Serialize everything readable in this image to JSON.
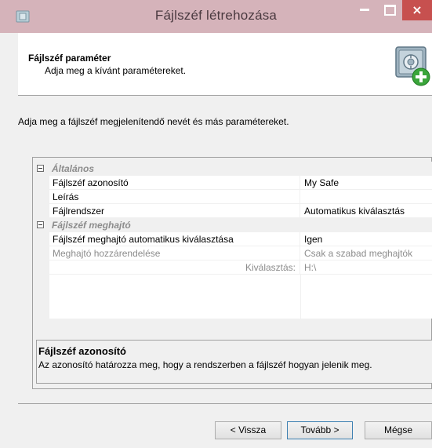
{
  "window": {
    "title": "Fájlszéf létrehozása",
    "close_glyph": "×"
  },
  "header": {
    "heading": "Fájlszéf paraméter",
    "subheading": "Adja meg a kívánt paramétereket.",
    "icon": "safe-add-icon"
  },
  "description": "Adja meg a fájlszéf megjelenítendő nevét és más paramétereket.",
  "property_grid": {
    "categories": [
      {
        "label": "Általános",
        "properties": [
          {
            "name": "Fájlszéf azonosító",
            "value": "My Safe"
          },
          {
            "name": "Leírás",
            "value": ""
          },
          {
            "name": "Fájlrendszer",
            "value": "Automatikus kiválasztás"
          }
        ]
      },
      {
        "label": "Fájlszéf meghajtó",
        "properties": [
          {
            "name": "Fájlszéf meghajtó automatikus kiválasztása",
            "value": "Igen"
          },
          {
            "name": "Meghajtó hozzárendelése",
            "value": "Csak a szabad meghajtók"
          },
          {
            "name": "Kiválasztás:",
            "value": "H:\\"
          }
        ]
      }
    ],
    "help": {
      "title": "Fájlszéf azonosító",
      "text": "Az azonosító határozza meg, hogy a rendszerben a fájlszéf hogyan jelenik meg."
    }
  },
  "buttons": {
    "back": "< Vissza",
    "next": "Tovább >",
    "cancel": "Mégse"
  },
  "colors": {
    "titlebar": "#d5b3ba",
    "close": "#c7504f",
    "safe_plus": "#3aa53a"
  }
}
